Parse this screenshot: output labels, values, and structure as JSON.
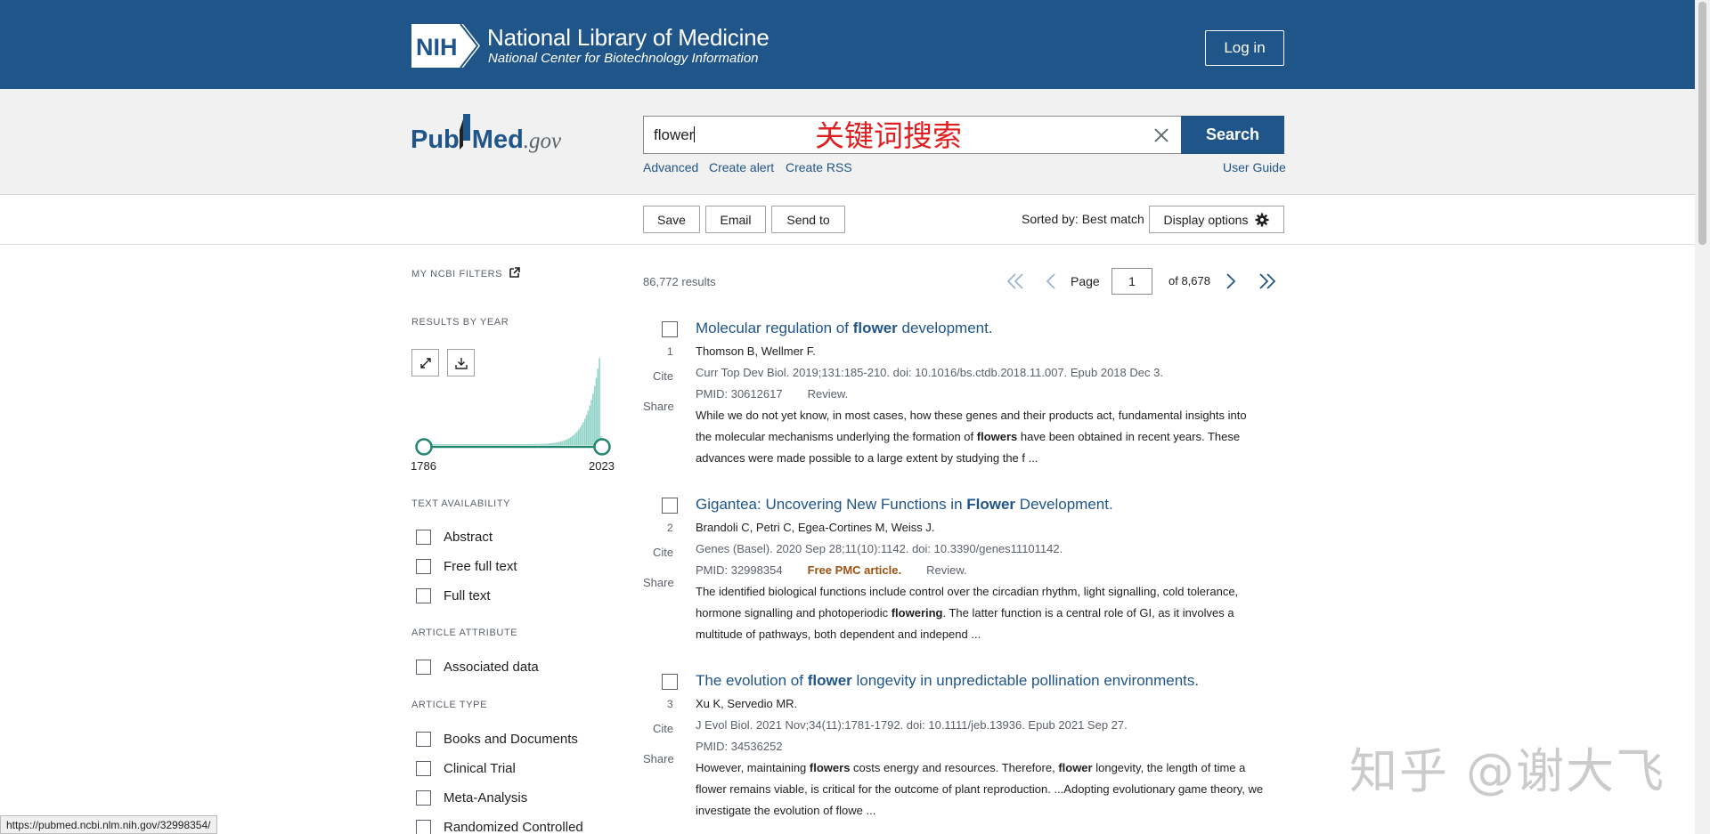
{
  "header": {
    "org_title": "National Library of Medicine",
    "org_subtitle": "National Center for Biotechnology Information",
    "logo_text": "NIH",
    "login_label": "Log in"
  },
  "search": {
    "logo_pub": "Pub",
    "logo_med": "Med",
    "logo_gov": ".gov",
    "query": "flower",
    "annotation": "关键词搜索",
    "search_label": "Search",
    "links": [
      "Advanced",
      "Create alert",
      "Create RSS"
    ],
    "user_guide": "User Guide"
  },
  "toolbar": {
    "save": "Save",
    "email": "Email",
    "send_to": "Send to",
    "sorted_by": "Sorted by: Best match",
    "display_options": "Display options"
  },
  "filters": {
    "my_ncbi": "MY NCBI FILTERS",
    "results_by_year": "RESULTS BY YEAR",
    "year_start": "1786",
    "year_end": "2023",
    "text_availability": "TEXT AVAILABILITY",
    "text_items": [
      "Abstract",
      "Free full text",
      "Full text"
    ],
    "article_attribute": "ARTICLE ATTRIBUTE",
    "attribute_items": [
      "Associated data"
    ],
    "article_type": "ARTICLE TYPE",
    "type_items": [
      "Books and Documents",
      "Clinical Trial",
      "Meta-Analysis",
      "Randomized Controlled"
    ]
  },
  "results": {
    "count": "86,772 results",
    "page_label": "Page",
    "page_value": "1",
    "of_pages": "of 8,678",
    "cite": "Cite",
    "share": "Share",
    "items": [
      {
        "num": "1",
        "title_pre": "Molecular regulation of ",
        "title_hl": "flower",
        "title_post": " development.",
        "authors": "Thomson B, Wellmer F.",
        "citation": "Curr Top Dev Biol. 2019;131:185-210. doi: 10.1016/bs.ctdb.2018.11.007. Epub 2018 Dec 3.",
        "pmid": "PMID: 30612617",
        "pmc": "",
        "type": "Review.",
        "snip_a": "While we do not yet know, in most cases, how these genes and their products act, fundamental insights into the molecular mechanisms underlying the formation of ",
        "snip_hl1": "flowers",
        "snip_b": " have been obtained in recent years. These advances were made possible to a large extent by studying the f ...",
        "snip_hl2": "",
        "snip_c": ""
      },
      {
        "num": "2",
        "title_pre": "Gigantea: Uncovering New Functions in ",
        "title_hl": "Flower",
        "title_post": " Development.",
        "authors": "Brandoli C, Petri C, Egea-Cortines M, Weiss J.",
        "citation": "Genes (Basel). 2020 Sep 28;11(10):1142. doi: 10.3390/genes11101142.",
        "pmid": "PMID: 32998354",
        "pmc": "Free PMC article.",
        "type": "Review.",
        "snip_a": "The identified biological functions include control over the circadian rhythm, light signalling, cold tolerance, hormone signalling and photoperiodic ",
        "snip_hl1": "flowering",
        "snip_b": ". The latter function is a central role of GI, as it involves a multitude of pathways, both dependent and independ ...",
        "snip_hl2": "",
        "snip_c": ""
      },
      {
        "num": "3",
        "title_pre": "The evolution of ",
        "title_hl": "flower",
        "title_post": " longevity in unpredictable pollination environments.",
        "authors": "Xu K, Servedio MR.",
        "citation": "J Evol Biol. 2021 Nov;34(11):1781-1792. doi: 10.1111/jeb.13936. Epub 2021 Sep 27.",
        "pmid": "PMID: 34536252",
        "pmc": "",
        "type": "",
        "snip_a": "However, maintaining ",
        "snip_hl1": "flowers",
        "snip_b": " costs energy and resources. Therefore, ",
        "snip_hl2": "flower",
        "snip_c": " longevity, the length of time a flower remains viable, is critical for the outcome of plant reproduction. ...Adopting evolutionary game theory, we investigate the evolution of flowe ..."
      }
    ]
  },
  "status_url": "https://pubmed.ncbi.nlm.nih.gov/32998354/",
  "watermark": "知乎 @谢大飞",
  "colors": {
    "nih_blue": "#20558a",
    "pmc_orange": "#9b5212",
    "annotation_red": "#e02020",
    "histogram_teal": "#8fd3c8"
  }
}
